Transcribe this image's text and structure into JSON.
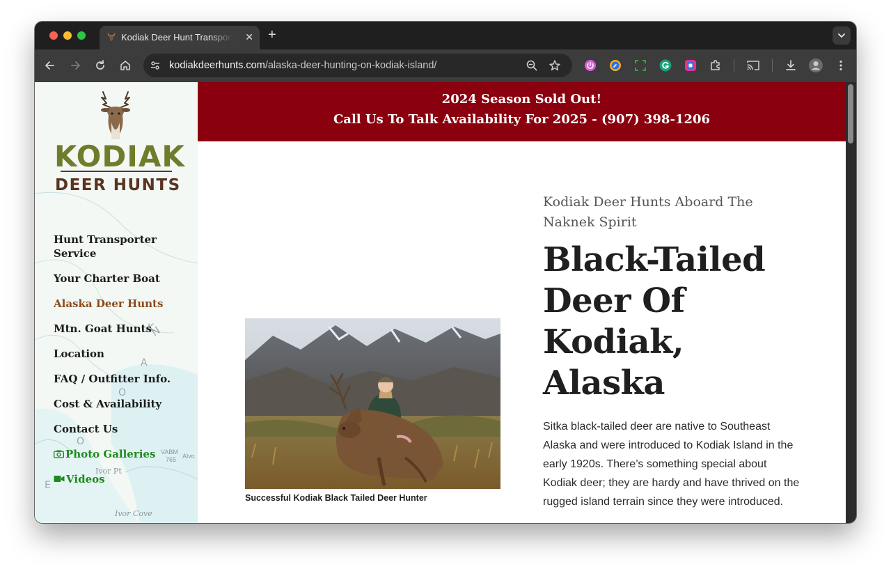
{
  "browser": {
    "tab_title": "Kodiak Deer Hunt Transportation",
    "url_host": "kodiakdeerhunts.com",
    "url_path": "/alaska-deer-hunting-on-kodiak-island/"
  },
  "site": {
    "logo_line1": "KODIAK",
    "logo_line2": "DEER HUNTS",
    "nav": [
      {
        "label": "Hunt Transporter Service"
      },
      {
        "label": "Your Charter Boat"
      },
      {
        "label": "Alaska Deer Hunts"
      },
      {
        "label": "Mtn. Goat Hunts"
      },
      {
        "label": "Location"
      },
      {
        "label": "FAQ / Outfitter Info."
      },
      {
        "label": "Cost & Availability"
      },
      {
        "label": "Contact Us"
      },
      {
        "label": "Photo Galleries"
      },
      {
        "label": "Videos"
      }
    ],
    "map_labels": [
      "Ivor Pt",
      "Ivor Cove",
      "VABM",
      "765",
      "Alvo"
    ]
  },
  "banner": {
    "line1": "2024 Season Sold Out!",
    "line2": "Call Us To Talk Availability For 2025 - (907) 398-1206"
  },
  "content": {
    "subtitle": "Kodiak Deer Hunts Aboard The Naknek Spirit",
    "heading": "Black-Tailed Deer Of Kodiak, Alaska",
    "photo_caption": "Successful Kodiak Black Tailed Deer Hunter",
    "body": "Sitka black-tailed deer are native to Southeast Alaska and were introduced to Kodiak Island in the early 1920s. There’s something special about Kodiak deer; they are hardy and have thrived on the rugged island terrain since they were introduced."
  },
  "colors": {
    "banner_bg": "#8b000e",
    "nav_active": "#8a4a1c",
    "nav_green": "#1d8a1d",
    "logo_green": "#6e7d2c",
    "logo_brown": "#5a3321"
  },
  "icons": {
    "photo_galleries": "camera-icon",
    "videos": "video-camera-icon"
  }
}
